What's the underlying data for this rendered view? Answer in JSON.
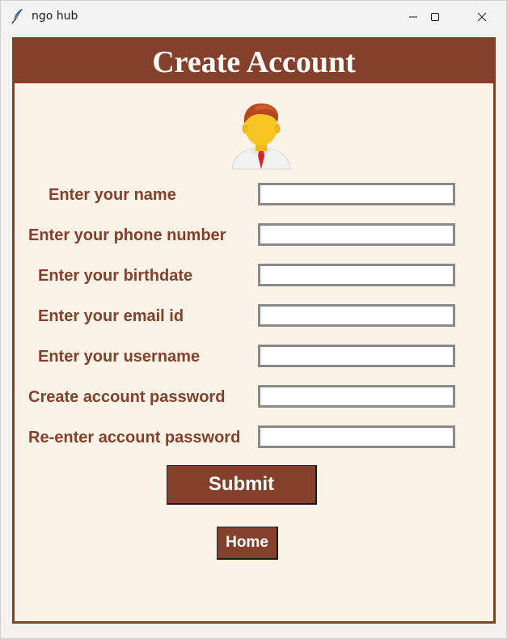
{
  "window": {
    "title": "ngo hub",
    "app_icon": "feather-icon",
    "controls": {
      "minimize_icon": "minimize-icon",
      "maximize_icon": "maximize-icon",
      "close_icon": "close-icon"
    }
  },
  "header": {
    "title": "Create Account"
  },
  "avatar": {
    "icon": "user-avatar-icon"
  },
  "form": {
    "fields": [
      {
        "label": "Enter your name",
        "value": ""
      },
      {
        "label": "Enter your phone number",
        "value": ""
      },
      {
        "label": "Enter your birthdate",
        "value": ""
      },
      {
        "label": "Enter your email id",
        "value": ""
      },
      {
        "label": "Enter your username",
        "value": ""
      },
      {
        "label": "Create account password",
        "value": ""
      },
      {
        "label": "Re-enter account password",
        "value": ""
      }
    ],
    "submit_label": "Submit",
    "home_label": "Home"
  },
  "colors": {
    "accent": "#84402a",
    "background": "#fbf3e8",
    "field_border": "#8a8a8a"
  }
}
